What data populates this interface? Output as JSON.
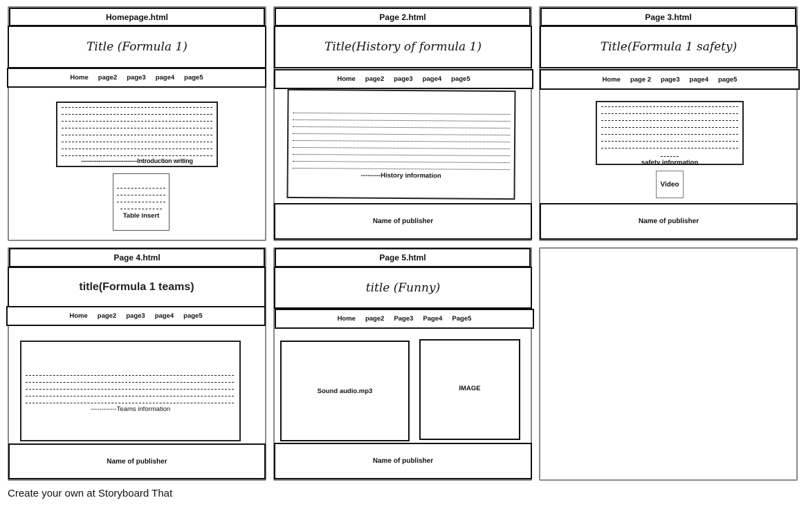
{
  "panels": [
    {
      "file": "Homepage.html",
      "title": "Title (Formula 1)",
      "nav": [
        "Home",
        "page2",
        "page3",
        "page4",
        "page5"
      ],
      "content": {
        "main_label": "-----------------------------Introduction writing",
        "secondary_label": "Table insert"
      }
    },
    {
      "file": "Page 2.html",
      "title": "Title(History of formula 1)",
      "nav": [
        "Home",
        "page2",
        "page3",
        "page4",
        "page5"
      ],
      "content": {
        "main_label": "---------History information"
      },
      "footer": "Name of publisher"
    },
    {
      "file": "Page 3.html",
      "title": "Title(Formula 1 safety)",
      "nav": [
        "Home",
        "page 2",
        "page3",
        "page4",
        "page5"
      ],
      "content": {
        "main_label": "safety information",
        "secondary_label": "Video"
      },
      "footer": "Name of publisher"
    },
    {
      "file": "Page 4.html",
      "title": "title(Formula 1 teams)",
      "nav": [
        "Home",
        "page2",
        "page3",
        "page4",
        "page5"
      ],
      "content": {
        "main_label": "------------Teams information"
      },
      "footer": "Name of publisher"
    },
    {
      "file": "Page 5.html",
      "title": "title (Funny)",
      "nav": [
        "Home",
        "page2",
        "Page3",
        "Page4",
        "Page5"
      ],
      "content": {
        "left_label": "Sound audio.mp3",
        "right_label": "IMAGE"
      },
      "footer": "Name of publisher"
    }
  ],
  "credit": "Create your own at Storyboard That"
}
